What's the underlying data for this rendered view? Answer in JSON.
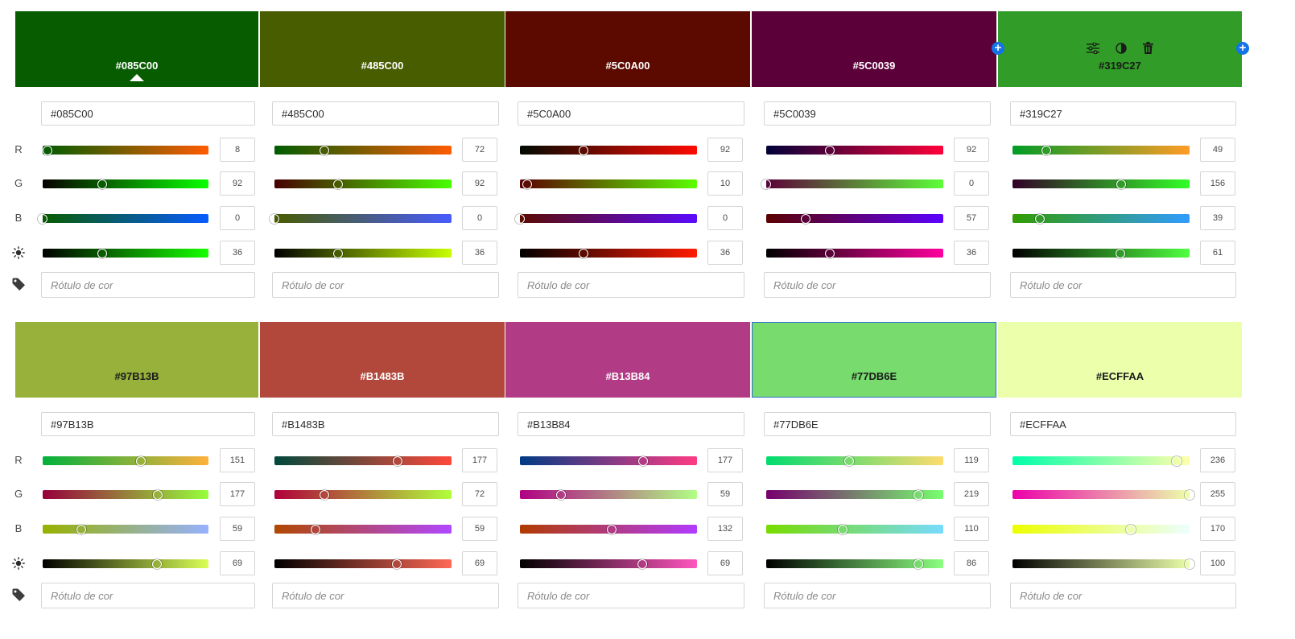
{
  "channel_labels": {
    "r": "R",
    "g": "G",
    "b": "B"
  },
  "icons": {
    "brightness": "brightness-icon",
    "tag": "tag-icon",
    "adjust": "sliders-icon",
    "contrast": "contrast-icon",
    "delete": "trash-icon",
    "add": "add-color-icon"
  },
  "label_placeholder": "Rótulo de cor",
  "rows": [
    {
      "colors": [
        {
          "hex": "#085C00",
          "r": 8,
          "g": 92,
          "b": 0,
          "brightness": 36,
          "text_color": "#ffffff",
          "selected": true
        },
        {
          "hex": "#485C00",
          "r": 72,
          "g": 92,
          "b": 0,
          "brightness": 36,
          "text_color": "#ffffff"
        },
        {
          "hex": "#5C0A00",
          "r": 92,
          "g": 10,
          "b": 0,
          "brightness": 36,
          "text_color": "#ffffff"
        },
        {
          "hex": "#5C0039",
          "r": 92,
          "g": 0,
          "b": 57,
          "brightness": 36,
          "text_color": "#ffffff"
        },
        {
          "hex": "#319C27",
          "r": 49,
          "g": 156,
          "b": 39,
          "brightness": 61,
          "text_color": "#1a1a1a",
          "hovered": true
        }
      ]
    },
    {
      "colors": [
        {
          "hex": "#97B13B",
          "r": 151,
          "g": 177,
          "b": 59,
          "brightness": 69,
          "text_color": "#1a1a1a"
        },
        {
          "hex": "#B1483B",
          "r": 177,
          "g": 72,
          "b": 59,
          "brightness": 69,
          "text_color": "#ffffff"
        },
        {
          "hex": "#B13B84",
          "r": 177,
          "g": 59,
          "b": 132,
          "brightness": 69,
          "text_color": "#ffffff"
        },
        {
          "hex": "#77DB6E",
          "r": 119,
          "g": 219,
          "b": 110,
          "brightness": 86,
          "text_color": "#1a1a1a",
          "outlined": true
        },
        {
          "hex": "#ECFFAA",
          "r": 236,
          "g": 255,
          "b": 170,
          "brightness": 100,
          "text_color": "#1a1a1a"
        }
      ]
    }
  ]
}
